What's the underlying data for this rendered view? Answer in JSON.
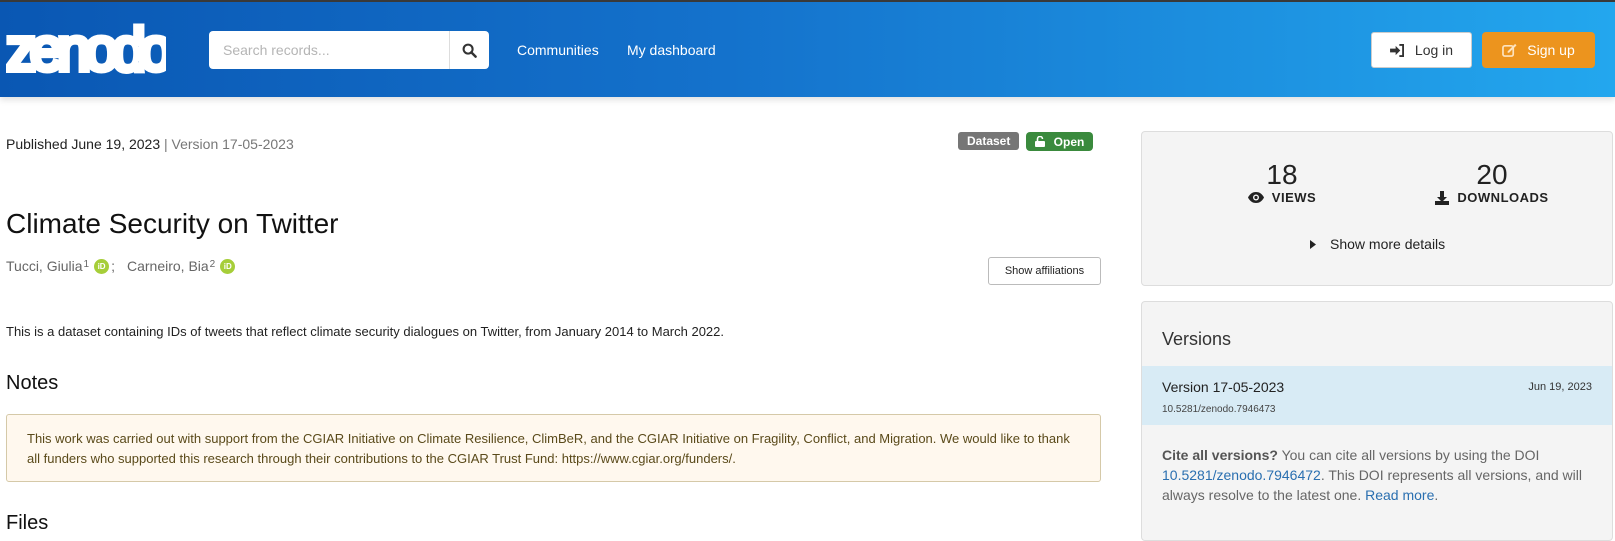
{
  "header": {
    "logo_text": "zenodo",
    "search_placeholder": "Search records...",
    "nav": [
      "Communities",
      "My dashboard"
    ],
    "login_label": "Log in",
    "signup_label": "Sign up",
    "brand_colors": {
      "header_start": "#0a57b3",
      "header_end": "#23a7ee",
      "signup": "#ec941e"
    }
  },
  "record": {
    "published": "Published June 19, 2023",
    "separator": " | ",
    "version": "Version 17-05-2023",
    "badges": {
      "type": "Dataset",
      "access": "Open"
    },
    "title": "Climate Security on Twitter",
    "authors": [
      {
        "name": "Tucci, Giulia",
        "affiliation": "1",
        "orcid": "iD"
      },
      {
        "name": "Carneiro, Bia",
        "affiliation": "2",
        "orcid": "iD"
      }
    ],
    "author_separator": ";",
    "show_affiliations_label": "Show affiliations",
    "description": "This is a dataset containing IDs of tweets that reflect climate security dialogues on Twitter, from January 2014 to March 2022.",
    "notes_heading": "Notes",
    "notes_text": "This work was carried out with support from the CGIAR Initiative on Climate Resilience, ClimBeR, and the CGIAR Initiative on Fragility, Conflict, and Migration. We would like to thank all funders who supported this research through their contributions to the CGIAR Trust Fund: https://www.cgiar.org/funders/.",
    "files_heading": "Files"
  },
  "stats": {
    "views": {
      "value": "18",
      "label": "VIEWS"
    },
    "downloads": {
      "value": "20",
      "label": "DOWNLOADS"
    },
    "more_label": "Show more details"
  },
  "versions": {
    "heading": "Versions",
    "items": [
      {
        "name": "Version 17-05-2023",
        "date": "Jun 19, 2023",
        "doi": "10.5281/zenodo.7946473"
      }
    ],
    "cite_bold": "Cite all versions?",
    "cite_text1": " You can cite all versions by using the DOI ",
    "cite_doi": "10.5281/zenodo.7946472",
    "cite_text2": ". This DOI represents all versions, and will always resolve to the latest one. ",
    "read_more": "Read more",
    "cite_end": "."
  }
}
